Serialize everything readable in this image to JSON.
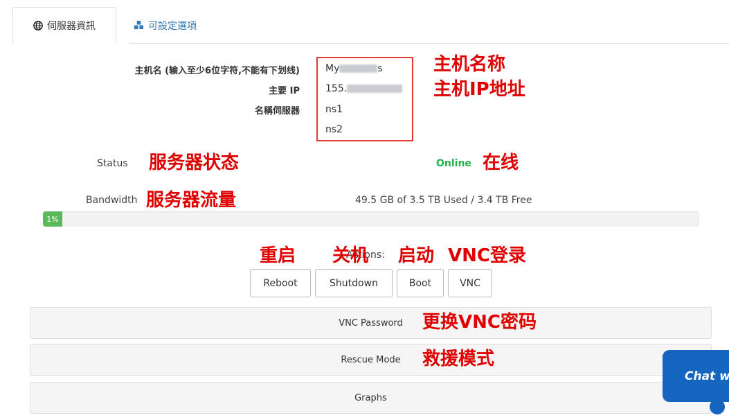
{
  "tabs": {
    "server_info": "伺服器資訊",
    "settings": "可設定選項"
  },
  "info": {
    "hostname_label": "主机名 (输入至少6位字符,不能有下划线)",
    "hostname_value_prefix": "My",
    "hostname_value_suffix": "s",
    "main_ip_label": "主要 IP",
    "main_ip_prefix": "155.",
    "nameserver_label": "名稱伺服器",
    "ns1": "ns1",
    "ns2": "ns2"
  },
  "annotations": {
    "hostname": "主机名称",
    "ip": "主机IP地址",
    "status": "服务器状态",
    "online": "在线",
    "bandwidth": "服务器流量",
    "reboot": "重启",
    "shutdown": "关机",
    "boot": "启动",
    "vnc": "VNC登录",
    "vnc_password": "更换VNC密码",
    "rescue": "救援模式"
  },
  "status": {
    "label": "Status",
    "value": "Online",
    "online_color": "#22b14c"
  },
  "bandwidth": {
    "label": "Bandwidth",
    "usage_text": "49.5 GB of 3.5 TB Used / 3.4 TB Free",
    "percent_label": "1%",
    "percent": 1
  },
  "actions": {
    "label": "Actions:",
    "reboot": "Reboot",
    "shutdown": "Shutdown",
    "boot": "Boot",
    "vnc": "VNC"
  },
  "panels": {
    "vnc_password": "VNC Password",
    "rescue_mode": "Rescue Mode",
    "graphs": "Graphs"
  },
  "chat": {
    "label": "Chat wit"
  },
  "colors": {
    "annotation_red": "#e00000",
    "link_blue": "#337ab7",
    "progress_green": "#5cb85c",
    "chat_blue": "#1565c0"
  }
}
